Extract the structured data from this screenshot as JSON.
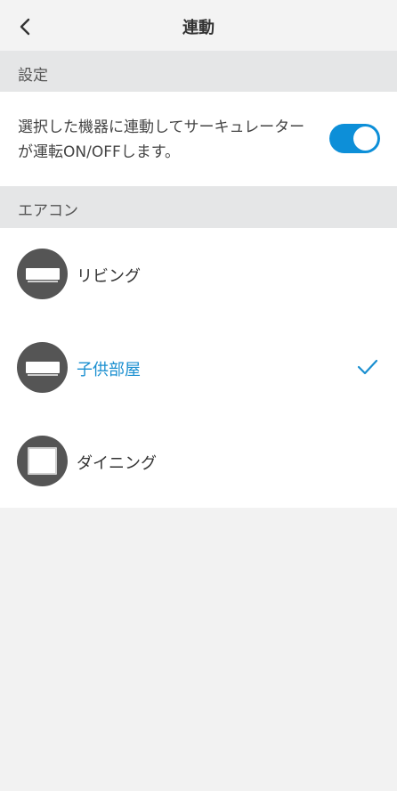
{
  "header": {
    "back_icon": "chevron-left-icon",
    "title": "連動"
  },
  "settings_section": {
    "title": "設定",
    "description": "選択した機器に連動してサーキュレーターが運転ON/OFFします。",
    "toggle_on": true
  },
  "aircon_section": {
    "title": "エアコン",
    "items": [
      {
        "label": "リビング",
        "icon": "wall-ac-icon",
        "selected": false
      },
      {
        "label": "子供部屋",
        "icon": "wall-ac-icon",
        "selected": true
      },
      {
        "label": "ダイニング",
        "icon": "window-ac-icon",
        "selected": false
      }
    ]
  },
  "colors": {
    "accent": "#0d8fd8",
    "selected_text": "#1a8fd0",
    "section_bg": "#e5e6e7",
    "icon_bg": "#555555"
  }
}
